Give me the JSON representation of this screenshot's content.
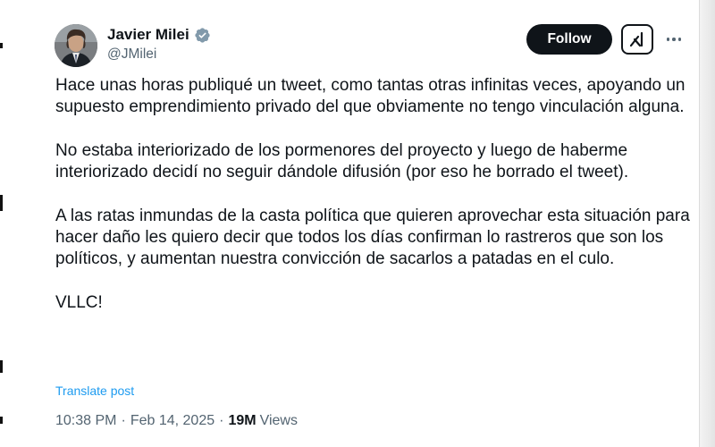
{
  "author": {
    "display_name": "Javier Milei",
    "handle": "@JMilei",
    "verified": true,
    "verified_color": "#829aab"
  },
  "actions": {
    "follow_label": "Follow",
    "grok_icon": "grok-icon",
    "more_icon": "more-icon"
  },
  "tweet": {
    "paragraphs": [
      "Hace unas horas publiqué un tweet, como tantas otras infinitas veces, apoyando un supuesto emprendimiento privado del que obviamente no tengo vinculación alguna.",
      "No estaba interiorizado de los pormenores del proyecto y luego de haberme interiorizado decidí no seguir dándole difusión (por eso he borrado el tweet).",
      "A las ratas inmundas de la casta política que quieren aprovechar esta situación para hacer daño les quiero decir que todos los días confirman lo rastreros que son los políticos, y aumentan nuestra convicción de sacarlos a patadas en el culo.",
      "VLLC!"
    ],
    "translate_label": "Translate post",
    "time": "10:38 PM",
    "date": "Feb 14, 2025",
    "separator": "·",
    "views_count": "19M",
    "views_label": "Views"
  },
  "colors": {
    "text": "#0f1419",
    "secondary": "#536471",
    "link": "#1d9bf0",
    "button_bg": "#0f1419"
  }
}
